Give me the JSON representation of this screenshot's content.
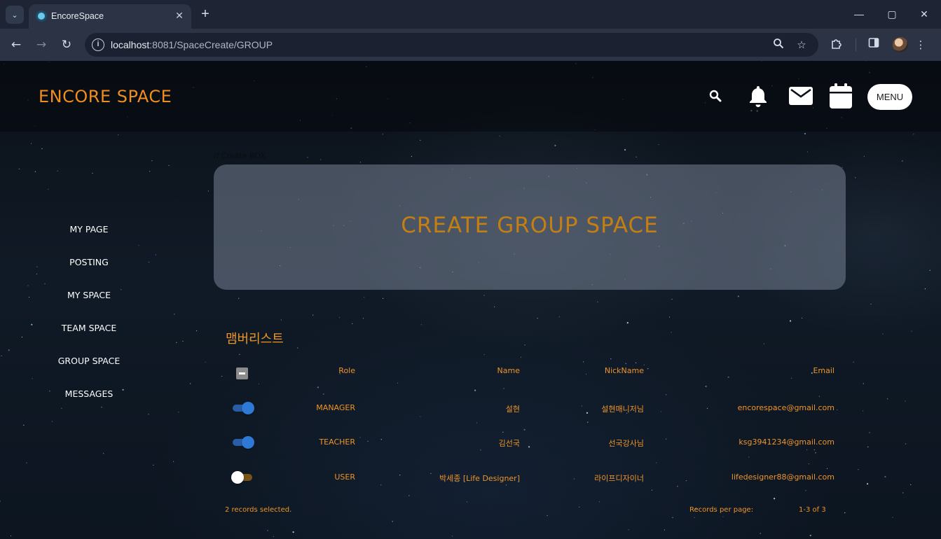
{
  "browser": {
    "tab_title": "EncoreSpace",
    "url_host": "localhost",
    "url_path": ":8081/SpaceCreate/GROUP"
  },
  "header": {
    "logo": "ENCORE SPACE",
    "menu_label": "MENU"
  },
  "sidebar": {
    "items": [
      {
        "label": "MY PAGE"
      },
      {
        "label": "POSTING"
      },
      {
        "label": "MY SPACE"
      },
      {
        "label": "TEAM SPACE"
      },
      {
        "label": "GROUP SPACE"
      },
      {
        "label": "MESSAGES"
      }
    ]
  },
  "main": {
    "comment": "// Create BOX",
    "create_title": "CREATE GROUP SPACE",
    "list_title": "맴버리스트"
  },
  "table": {
    "headers": {
      "role": "Role",
      "name": "Name",
      "nickname": "NickName",
      "email": "Email"
    },
    "rows": [
      {
        "role": "MANAGER",
        "name": "설현",
        "nickname": "설현매니저님",
        "email": "encorespace@gmail.com",
        "selected": true
      },
      {
        "role": "TEACHER",
        "name": "김선국",
        "nickname": "선국강사님",
        "email": "ksg3941234@gmail.com",
        "selected": true
      },
      {
        "role": "USER",
        "name": "박세종 [Life Designer]",
        "nickname": "라이프디자이너",
        "email": "lifedesigner88@gmail.com",
        "selected": false
      }
    ],
    "footer": {
      "selected_text": "2 records selected.",
      "records_per_page_label": "Records per page:",
      "range_text": "1-3 of 3"
    }
  },
  "colors": {
    "accent_orange": "#ef9428",
    "title_gold": "#c47f12",
    "toggle_on": "#2e78d6"
  }
}
